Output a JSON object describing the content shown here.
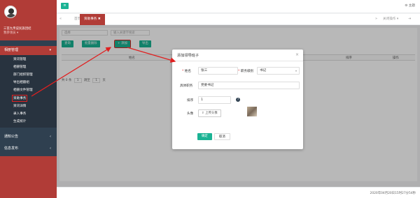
{
  "sidebar": {
    "school": "三苗九传说民族团结",
    "role": "我参领员 ▾",
    "groups": {
      "mgmt": "相册管理",
      "notice": "通知公告",
      "info": "信息发布"
    },
    "items": [
      "资讯管理",
      "相册管理",
      "部门组织管理",
      "导出相册组",
      "相册文件管理",
      "资助事务",
      "资讯详情",
      "录入事务",
      "生成统计"
    ]
  },
  "topbar": {
    "menu_icon": "≡",
    "theme": "⚙ 主题"
  },
  "tabs": {
    "home": "首页",
    "current": "资助事务 ✖",
    "close_ops": "关闭操作 ▾"
  },
  "filters": {
    "select": "选择",
    "input_placeholder": "输入关键字搜索"
  },
  "toolbar": {
    "search": "查询",
    "batch_delete": "批量删除",
    "add": "+ 添加",
    "export": "导出"
  },
  "table": {
    "col_name": "姓名",
    "col_sort": "排序",
    "col_op": "操作"
  },
  "pager": {
    "prefix": "共 0 条",
    "page": "1",
    "goto_label": "跳至",
    "page_box": "1",
    "unit": "页"
  },
  "footer": "2020年04月20日15时27分54秒",
  "modal": {
    "title": "添加领导班子",
    "close": "×",
    "name_label": "姓名",
    "name_value": "张三",
    "dept_label": "职务级别",
    "dept_value": "书记",
    "title_label": "具体职务",
    "title_value": "党委书记",
    "sort_label": "排序",
    "sort_value": "1",
    "help_icon": "?",
    "avatar_label": "头像",
    "upload": "⇪ 上传头像",
    "ok": "确定",
    "cancel": "取消"
  }
}
